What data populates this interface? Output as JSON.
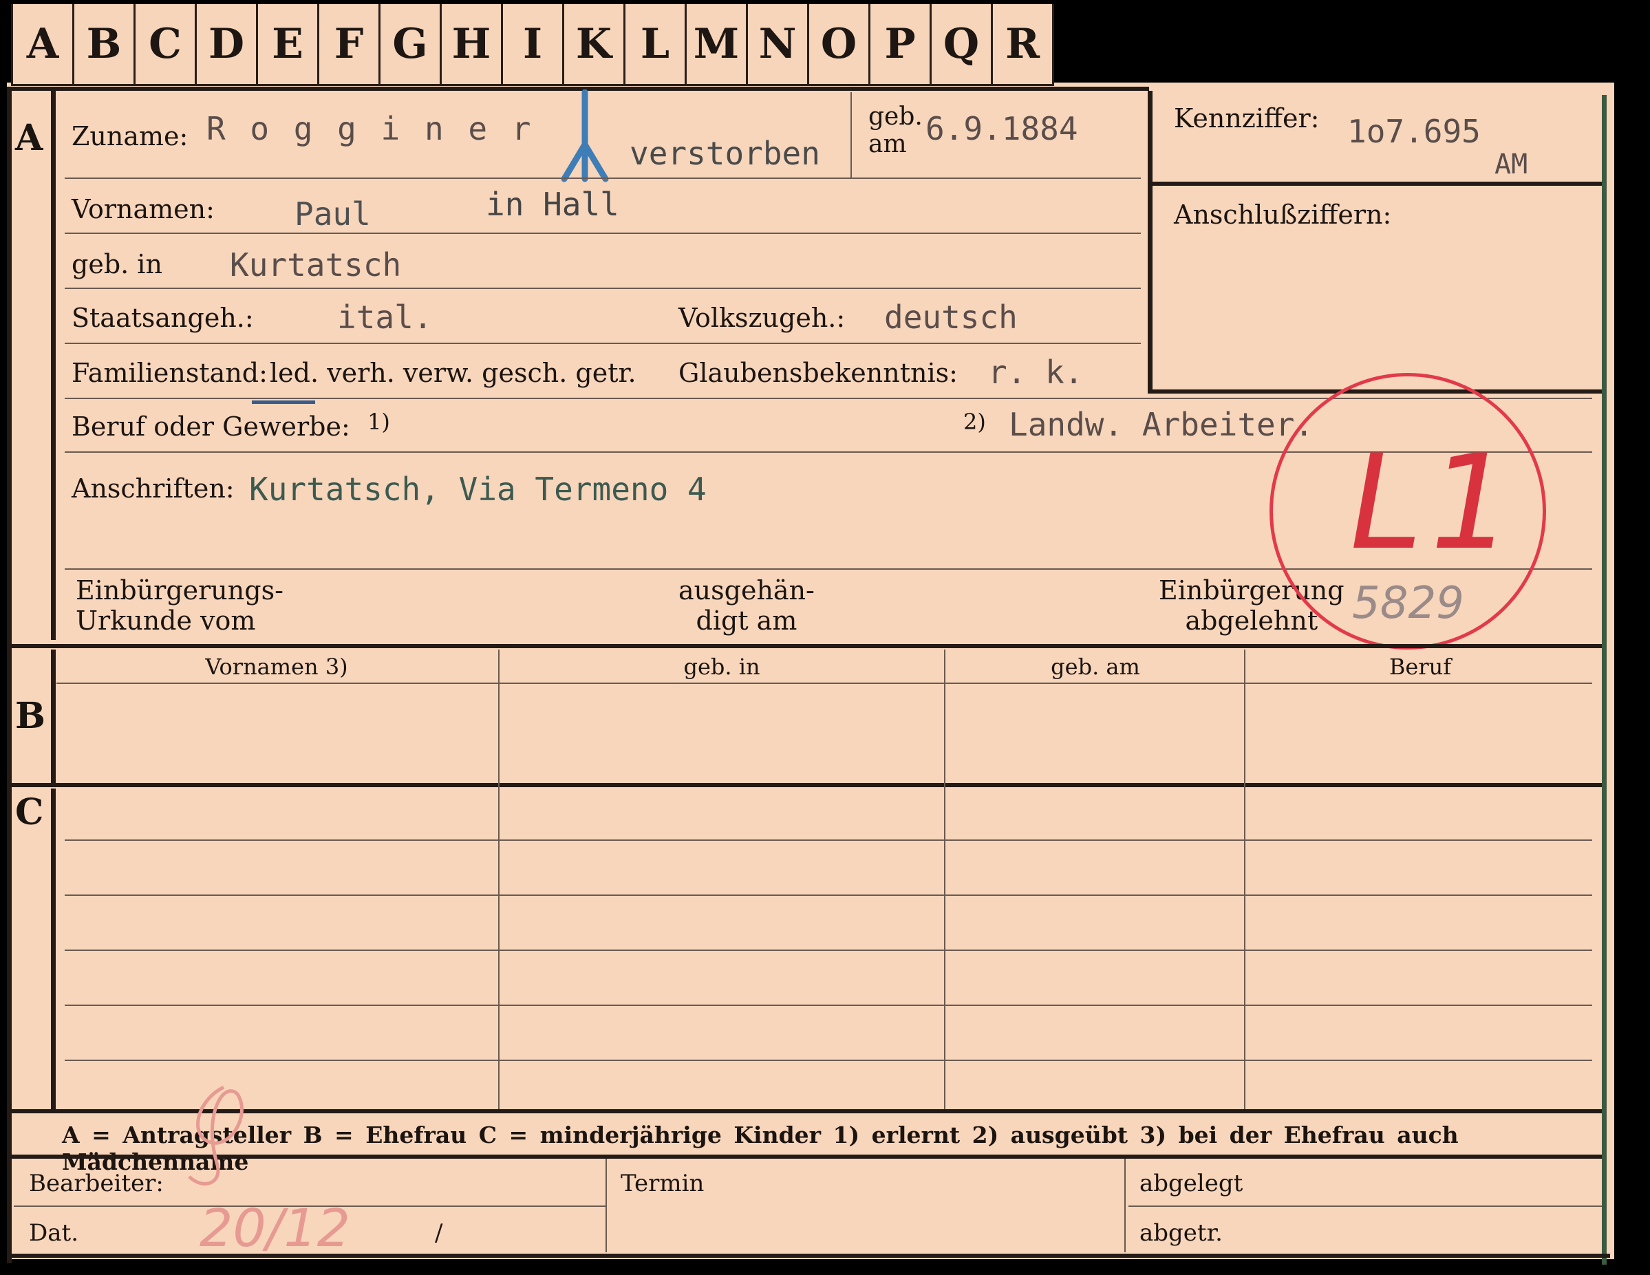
{
  "tabs": [
    "A",
    "B",
    "C",
    "D",
    "E",
    "F",
    "G",
    "H",
    "I",
    "K",
    "L",
    "M",
    "N",
    "O",
    "P",
    "Q",
    "R"
  ],
  "sections": {
    "a": "A",
    "b": "B",
    "c": "C"
  },
  "header": {
    "surname_label": "Zuname:",
    "surname_value": "R o g g i n e r",
    "deceased_note": "verstorben",
    "birth_label": "geb.\nam",
    "birth_date": "6.9.1884",
    "id_label": "Kennziffer:",
    "id_value": "1o7.695",
    "id_suffix": "AM",
    "connection_label": "Anschlußziffern:"
  },
  "fields": {
    "firstname_label": "Vornamen:",
    "firstname_value": "Paul",
    "death_place": "in Hall",
    "birthplace_label": "geb. in",
    "birthplace_value": "Kurtatsch",
    "citizenship_label": "Staatsangeh.:",
    "citizenship_value": "ital.",
    "ethnicity_label": "Volkszugeh.:",
    "ethnicity_value": "deutsch",
    "marital_label": "Familienstand:",
    "marital_options": "led. verh. verw. gesch. getr.",
    "religion_label": "Glaubensbekenntnis:",
    "religion_value": "r. k.",
    "occupation_label": "Beruf oder Gewerbe:",
    "occupation_note1": "1)",
    "occupation_note2": "2)",
    "occupation_value": "Landw. Arbeiter.",
    "address_label": "Anschriften:",
    "address_value": "Kurtatsch, Via Termeno 4",
    "naturalization_label": "Einbürgerungs-\nUrkunde vom",
    "handed_label": "ausgehän-\ndigt am",
    "refused_label": "Einbürgerung\nabgelehnt"
  },
  "stamp": {
    "code": "L1",
    "number": "5829",
    "color": "#e23a4a"
  },
  "spouse_table": {
    "headers": [
      "Vornamen 3)",
      "geb. in",
      "geb. am",
      "Beruf"
    ]
  },
  "legend": "A = Antragsteller   B = Ehefrau   C = minderjährige Kinder   1) erlernt   2) ausgeübt   3) bei der Ehefrau auch Mädchenname",
  "footer": {
    "clerk_label": "Bearbeiter:",
    "date_label": "Dat.",
    "date_value": "20/12",
    "date_sep": "/",
    "deadline_label": "Termin",
    "filed_label": "abgelegt",
    "removed_label": "abgetr."
  },
  "colors": {
    "card": "#f7d6bc",
    "stamp": "#e23a4a",
    "pencil": "#e79a92"
  }
}
